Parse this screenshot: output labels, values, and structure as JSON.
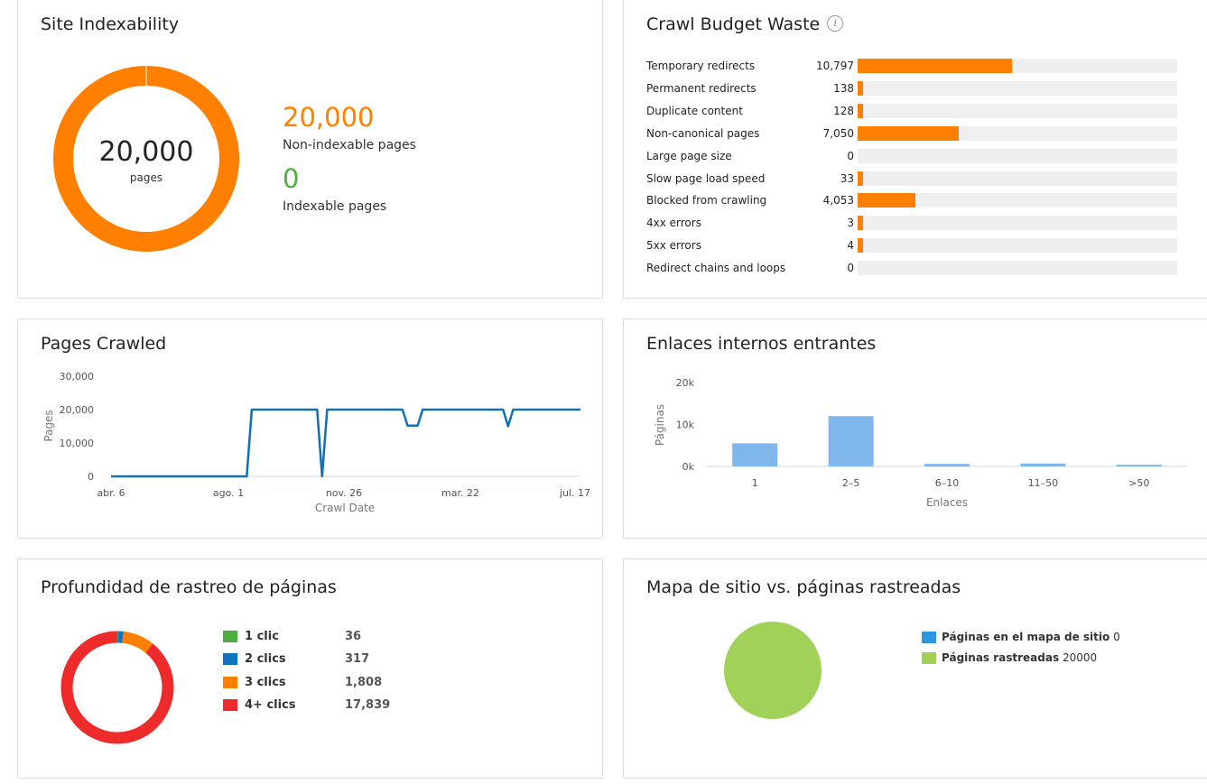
{
  "colors": {
    "orange": "#ff8000",
    "green": "#4caf3d",
    "blue": "#1272c4",
    "red": "#ee2a2a",
    "light_blue": "#7fb6ec",
    "sitemap_blue": "#2d97e0",
    "sitemap_green": "#a2d15a",
    "line_blue": "#1070b8"
  },
  "site_indexability": {
    "title": "Site Indexability",
    "donut_total": "20,000",
    "donut_unit": "pages",
    "non_indexable_value": "20,000",
    "non_indexable_label": "Non-indexable pages",
    "indexable_value": "0",
    "indexable_label": "Indexable pages",
    "chart_data": {
      "type": "pie",
      "categories": [
        "Non-indexable pages",
        "Indexable pages"
      ],
      "values": [
        20000,
        0
      ]
    }
  },
  "crawl_budget": {
    "title": "Crawl Budget Waste",
    "info_icon": "info-icon",
    "rows": [
      {
        "label": "Temporary redirects",
        "value": "10,797",
        "n": 10797
      },
      {
        "label": "Permanent redirects",
        "value": "138",
        "n": 138
      },
      {
        "label": "Duplicate content",
        "value": "128",
        "n": 128
      },
      {
        "label": "Non-canonical pages",
        "value": "7,050",
        "n": 7050
      },
      {
        "label": "Large page size",
        "value": "0",
        "n": 0
      },
      {
        "label": "Slow page load speed",
        "value": "33",
        "n": 33
      },
      {
        "label": "Blocked from crawling",
        "value": "4,053",
        "n": 4053
      },
      {
        "label": "4xx errors",
        "value": "3",
        "n": 3
      },
      {
        "label": "5xx errors",
        "value": "4",
        "n": 4
      },
      {
        "label": "Redirect chains and loops",
        "value": "0",
        "n": 0
      }
    ],
    "scale_max": 22300
  },
  "pages_crawled": {
    "title": "Pages Crawled",
    "chart_data": {
      "type": "line",
      "xlabel": "Crawl Date",
      "ylabel": "Pages",
      "y_ticks": [
        "0",
        "10,000",
        "20,000",
        "30,000"
      ],
      "x_ticks": [
        "abr. 6",
        "ago. 1",
        "nov. 26",
        "mar. 22",
        "jul. 17"
      ],
      "ylim": [
        0,
        30000
      ],
      "xlim": [
        0,
        467
      ],
      "points": [
        [
          0,
          0
        ],
        [
          135,
          0
        ],
        [
          140,
          20000
        ],
        [
          205,
          20000
        ],
        [
          210,
          0
        ],
        [
          215,
          20000
        ],
        [
          290,
          20000
        ],
        [
          295,
          15200
        ],
        [
          305,
          15200
        ],
        [
          310,
          20000
        ],
        [
          390,
          20000
        ],
        [
          395,
          15000
        ],
        [
          400,
          20000
        ],
        [
          467,
          20000
        ]
      ]
    }
  },
  "enlaces": {
    "title": "Enlaces internos entrantes",
    "chart_data": {
      "type": "bar",
      "xlabel": "Enlaces",
      "ylabel": "Páginas",
      "categories": [
        "1",
        "2–5",
        "6–10",
        "11–50",
        ">50"
      ],
      "values": [
        5500,
        12000,
        600,
        700,
        400
      ],
      "y_ticks": [
        "0k",
        "10k",
        "20k"
      ],
      "ylim": [
        0,
        20000
      ]
    }
  },
  "profundidad": {
    "title": "Profundidad de rastreo de páginas",
    "legend": [
      {
        "name": "1 clic",
        "value": "36",
        "n": 36,
        "color": "#4caf3d"
      },
      {
        "name": "2 clics",
        "value": "317",
        "n": 317,
        "color": "#1272c4"
      },
      {
        "name": "3 clics",
        "value": "1,808",
        "n": 1808,
        "color": "#ff8000"
      },
      {
        "name": "4+ clics",
        "value": "17,839",
        "n": 17839,
        "color": "#ee2a2a"
      }
    ]
  },
  "sitemap": {
    "title": "Mapa de sitio vs. páginas rastreadas",
    "legend": [
      {
        "name": "Páginas en el mapa de sitio",
        "value": "0",
        "color": "#2d97e0"
      },
      {
        "name": "Páginas rastreadas",
        "value": "20000",
        "color": "#a2d15a"
      }
    ]
  }
}
